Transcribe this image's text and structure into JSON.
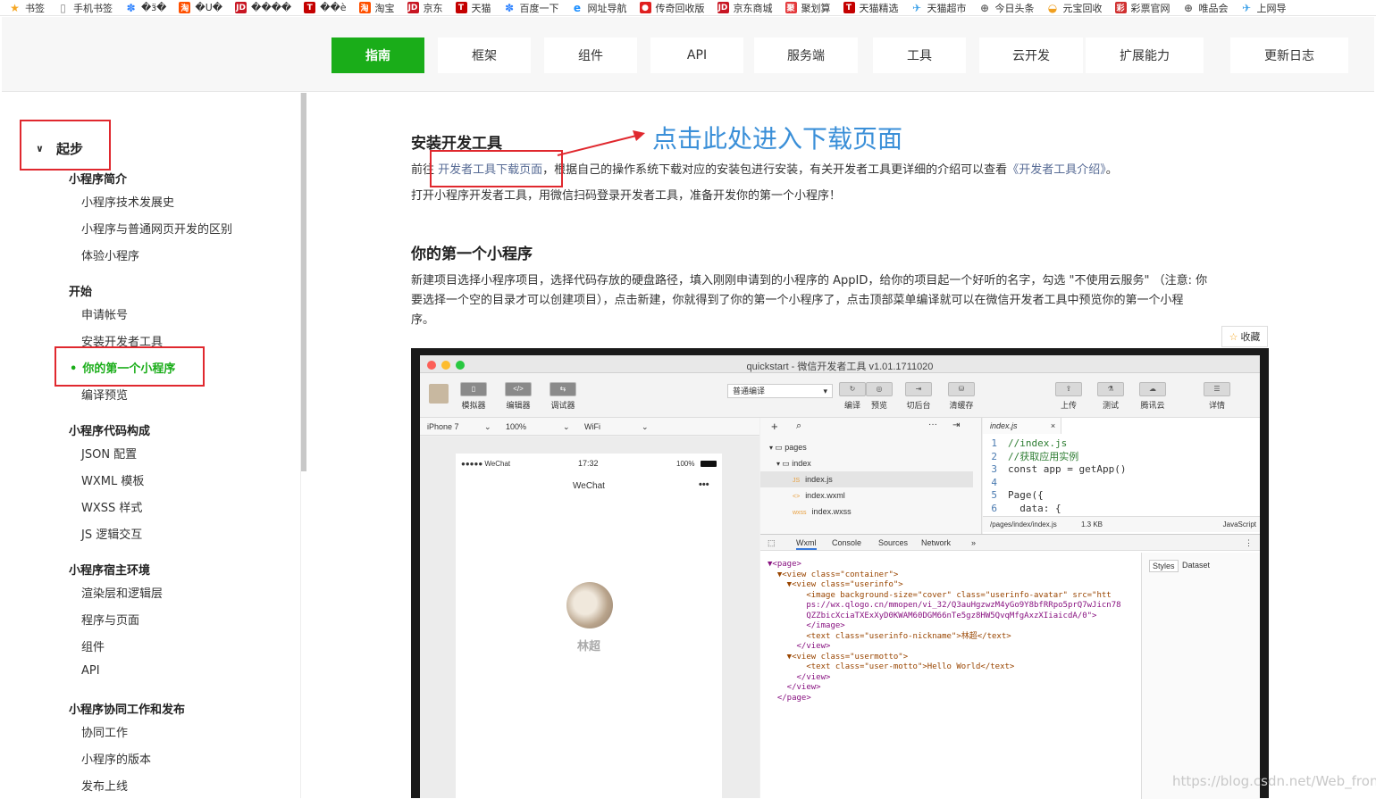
{
  "bookmarks": [
    {
      "label": "书签",
      "icon": "star-icon",
      "color": "#f5a623"
    },
    {
      "label": "手机书签",
      "icon": "phone-icon",
      "color": "#888888"
    },
    {
      "label": "�ӟ�",
      "icon": "baidu-paw-icon",
      "color": "#3385ff"
    },
    {
      "label": "�U�",
      "icon": "taobao-icon",
      "color": "#ff5000"
    },
    {
      "label": "����",
      "icon": "jd-icon",
      "color": "#c81623"
    },
    {
      "label": "��è",
      "icon": "tmall-icon",
      "color": "#c40000"
    },
    {
      "label": "淘宝",
      "icon": "taobao-icon",
      "color": "#ff5000"
    },
    {
      "label": "京东",
      "icon": "jd-icon",
      "color": "#c81623"
    },
    {
      "label": "天猫",
      "icon": "tmall-icon",
      "color": "#c40000"
    },
    {
      "label": "百度一下",
      "icon": "baidu-paw-icon",
      "color": "#3385ff"
    },
    {
      "label": "网址导航",
      "icon": "ie-icon",
      "color": "#1e90ff"
    },
    {
      "label": "传奇回收版",
      "icon": "game-icon",
      "color": "#e02020"
    },
    {
      "label": "京东商城",
      "icon": "jd-icon",
      "color": "#c81623"
    },
    {
      "label": "聚划算",
      "icon": "juhuasuan-icon",
      "color": "#e4393c"
    },
    {
      "label": "天猫精选",
      "icon": "tmall-icon",
      "color": "#c40000"
    },
    {
      "label": "天猫超市",
      "icon": "bird-icon",
      "color": "#3aa0e8"
    },
    {
      "label": "今日头条",
      "icon": "globe-icon",
      "color": "#666666"
    },
    {
      "label": "元宝回收",
      "icon": "ingot-icon",
      "color": "#f0a020"
    },
    {
      "label": "彩票官网",
      "icon": "lottery-icon",
      "color": "#d03030"
    },
    {
      "label": "唯品会",
      "icon": "globe-icon",
      "color": "#666666"
    },
    {
      "label": "上网导",
      "icon": "bird-icon",
      "color": "#3aa0e8"
    }
  ],
  "nav": {
    "tabs": [
      "指南",
      "框架",
      "组件",
      "API",
      "服务端",
      "工具",
      "云开发",
      "扩展能力",
      "更新日志"
    ],
    "active_color": "#1aad19"
  },
  "sidebar": {
    "section": "起步",
    "groups": [
      {
        "title": "小程序简介",
        "items": [
          "小程序技术发展史",
          "小程序与普通网页开发的区别",
          "体验小程序"
        ]
      },
      {
        "title": "开始",
        "items": [
          "申请帐号",
          "安装开发者工具",
          "你的第一个小程序",
          "编译预览"
        ]
      },
      {
        "title": "小程序代码构成",
        "items": [
          "JSON 配置",
          "WXML 模板",
          "WXSS 样式",
          "JS 逻辑交互"
        ]
      },
      {
        "title": "小程序宿主环境",
        "items": [
          "渲染层和逻辑层",
          "程序与页面",
          "组件",
          "API"
        ]
      },
      {
        "title": "小程序协同工作和发布",
        "items": [
          "协同工作",
          "小程序的版本",
          "发布上线"
        ]
      }
    ],
    "active_item": "你的第一个小程序"
  },
  "main": {
    "h_install": "安装开发工具",
    "annotation": "点击此处进入下载页面",
    "p1_prefix": "前往",
    "p1_link": "开发者工具下载页面",
    "p1_mid": "，根据自己的操作系统下载对应的安装包进行安装，有关开发者工具更详细的介绍可以查看",
    "p1_link2": "《开发者工具介绍》",
    "p1_end": "。",
    "p2": "打开小程序开发者工具，用微信扫码登录开发者工具，准备开发你的第一个小程序！",
    "h_first": "你的第一个小程序",
    "p3_line1": "新建项目选择小程序项目，选择代码存放的硬盘路径，填入刚刚申请到的小程序的 AppID，给你的项目起一个好听的名字，勾选 \"不使用云服务\" （注意: 你",
    "p3_line2": "要选择一个空的目录才可以创建项目），点击新建，你就得到了你的第一个小程序了，点击顶部菜单编译就可以在微信开发者工具中预览你的第一个小程",
    "p3_line3": "序。",
    "fav": "收藏"
  },
  "ide": {
    "title": "quickstart - 微信开发者工具 v1.01.1711020",
    "tools_left": [
      "模拟器",
      "编辑器",
      "调试器"
    ],
    "compile_mode": "普通编译",
    "tools_mid": [
      "编译",
      "预览",
      "切后台",
      "清缓存"
    ],
    "tools_right": [
      "上传",
      "测试",
      "腾讯云",
      "详情"
    ],
    "device": "iPhone 7",
    "zoom": "100%",
    "network": "WiFi",
    "phone_status_left": "●●●●● WeChat",
    "phone_time": "17:32",
    "phone_battery": "100%",
    "phone_title": "WeChat",
    "phone_more": "•••",
    "nickname": "林超",
    "tree": [
      "pages",
      "index",
      "index.js",
      "index.wxml",
      "index.wxss"
    ],
    "tree_badges": [
      "JS",
      "<>",
      "wxss"
    ],
    "editor_tab": "index.js",
    "code_lines": [
      {
        "n": "1",
        "t": "//index.js"
      },
      {
        "n": "2",
        "t": "//获取应用实例"
      },
      {
        "n": "3",
        "t": "const app = getApp()"
      },
      {
        "n": "4",
        "t": ""
      },
      {
        "n": "5",
        "t": "Page({"
      },
      {
        "n": "6",
        "t": "  data: {"
      }
    ],
    "editor_status_path": "/pages/index/index.js",
    "editor_status_size": "1.3 KB",
    "editor_status_lang": "JavaScript",
    "devtools_tabs": [
      "Wxml",
      "Console",
      "Sources",
      "Network",
      "»"
    ],
    "side_tabs": [
      "Styles",
      "Dataset"
    ],
    "wxml": [
      "▼<page>",
      "  ▼<view class=\"container\">",
      "    ▼<view class=\"userinfo\">",
      "        <image background-size=\"cover\" class=\"userinfo-avatar\" src=\"htt",
      "        ps://wx.qlogo.cn/mmopen/vi_32/Q3auHgzwzM4yGo9Y8bfRRpo5prQ7wJicn78",
      "        QZZbicXciaTXExXyD0KWAM60DGM66nTe5gz8HW5QvqMfgAxzXIiaicdA/0\">",
      "        </image>",
      "        <text class=\"userinfo-nickname\">林超</text>",
      "      </view>",
      "    ▼<view class=\"usermotto\">",
      "        <text class=\"user-motto\">Hello World</text>",
      "      </view>",
      "    </view>",
      "  </page>"
    ]
  },
  "watermark": "https://blog.csdn.net/Web_front"
}
